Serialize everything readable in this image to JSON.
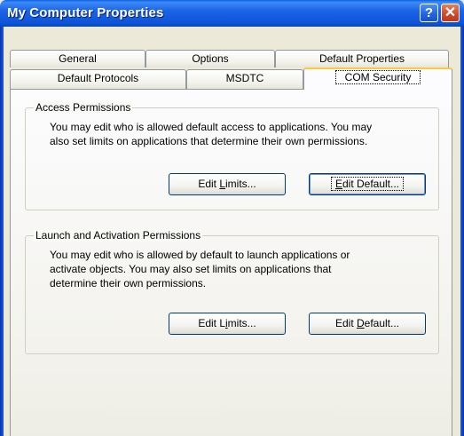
{
  "window": {
    "title": "My Computer Properties",
    "help_glyph": "?",
    "close_glyph": "✕"
  },
  "tabs": {
    "row_top": [
      {
        "label": "General"
      },
      {
        "label": "Options"
      },
      {
        "label": "Default Properties"
      }
    ],
    "row_bottom": [
      {
        "label": "Default Protocols"
      },
      {
        "label": "MSDTC"
      },
      {
        "label": "COM Security",
        "active": true
      }
    ]
  },
  "access_permissions": {
    "legend": "Access Permissions",
    "line1": "You may edit who is allowed default access to applications. You may",
    "line2": "also set limits on applications that determine their own permissions.",
    "edit_limits": {
      "pre": "Edit ",
      "key": "L",
      "post": "imits..."
    },
    "edit_default": {
      "pre": "",
      "key": "E",
      "post": "dit Default..."
    }
  },
  "launch_permissions": {
    "legend": "Launch and Activation Permissions",
    "line1": "You may edit who is allowed by default to launch applications or",
    "line2": "activate objects. You may also set limits on applications that",
    "line3": "determine their own permissions.",
    "edit_limits": {
      "pre": "Edit L",
      "key": "i",
      "post": "mits..."
    },
    "edit_default": {
      "pre": "Edit ",
      "key": "D",
      "post": "efault..."
    }
  },
  "colors": {
    "titlebar": "#0a5fe4",
    "window_bg": "#ece9d8",
    "active_tab_highlight": "#ffc83c",
    "close_button": "#d0482a"
  }
}
